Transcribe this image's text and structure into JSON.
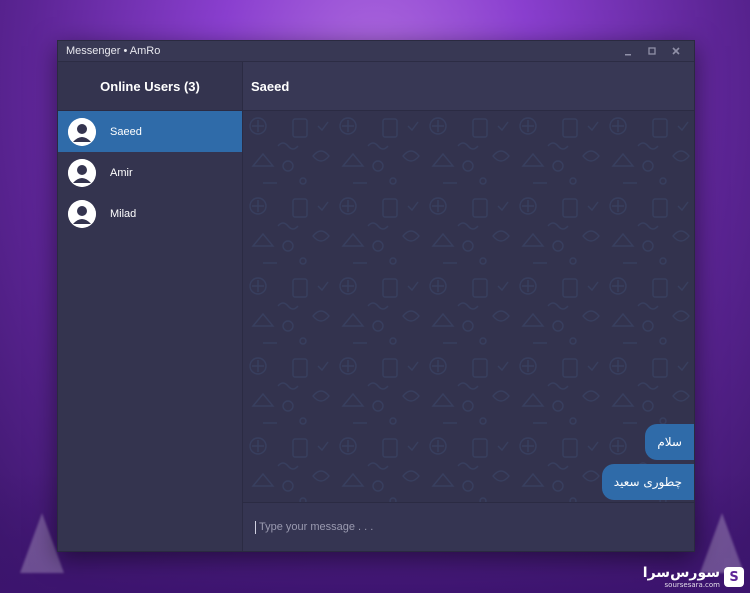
{
  "window": {
    "title": "Messenger • AmRo"
  },
  "sidebar": {
    "header": "Online Users (3)",
    "users": [
      {
        "name": "Saeed",
        "active": true
      },
      {
        "name": "Amir",
        "active": false
      },
      {
        "name": "Milad",
        "active": false
      }
    ]
  },
  "chat": {
    "recipient": "Saeed",
    "messages": [
      {
        "text": "سلام",
        "outgoing": true
      },
      {
        "text": "چطوری سعید",
        "outgoing": true
      }
    ],
    "input": {
      "value": "",
      "placeholder": "Type your message . . ."
    }
  },
  "watermark": {
    "text": "سورس‌سرا",
    "sub": "soursesara.com"
  },
  "colors": {
    "accent": "#2f6ba9",
    "window_bg": "#353551",
    "text": "#ffffff"
  },
  "icons": {
    "minimize": "minimize-icon",
    "maximize": "maximize-icon",
    "close": "close-icon",
    "avatar": "user-avatar-icon"
  }
}
